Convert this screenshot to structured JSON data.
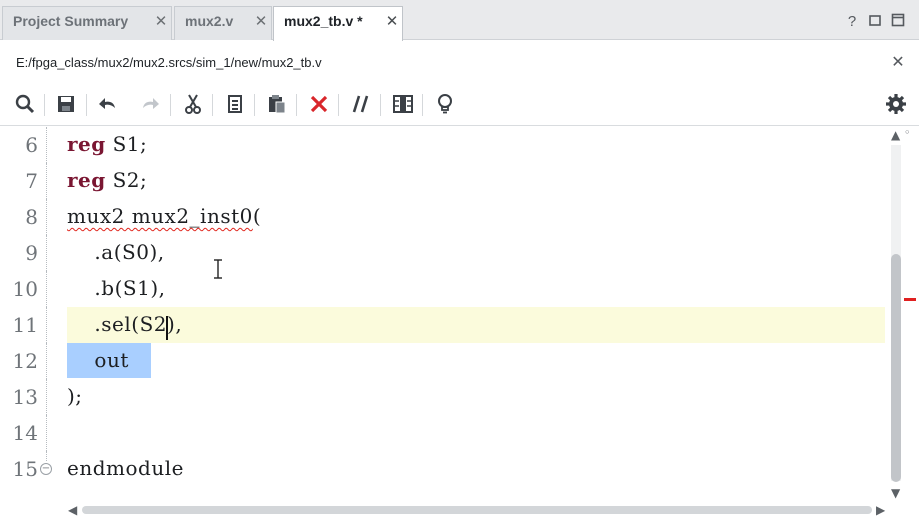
{
  "tabs": [
    {
      "label": "Project Summary",
      "close": "✕"
    },
    {
      "label": "mux2.v",
      "close": "✕"
    },
    {
      "label": "mux2_tb.v *",
      "close": "✕"
    }
  ],
  "window_controls": {
    "help": "?",
    "restore": "☐",
    "maximize": "◻"
  },
  "file_path": "E:/fpga_class/mux2/mux2.srcs/sim_1/new/mux2_tb.v",
  "path_close": "✕",
  "toolbar_icons": [
    "search-icon",
    "save-icon",
    "undo-icon",
    "redo-icon",
    "cut-icon",
    "copy-icon",
    "paste-icon",
    "delete-icon",
    "comment-icon",
    "columns-icon",
    "lightbulb-icon",
    "settings-icon"
  ],
  "editor": {
    "lines": [
      {
        "num": "6",
        "kw": "reg",
        "text": " S1;"
      },
      {
        "num": "7",
        "kw": "reg",
        "text": " S2;"
      },
      {
        "num": "8",
        "squig": "mux2 mux2_inst0",
        "text": "("
      },
      {
        "num": "9",
        "text": "    .a(S0),"
      },
      {
        "num": "10",
        "text": "    .b(S1),"
      },
      {
        "num": "11",
        "before": "    .sel(S2",
        "after": "),"
      },
      {
        "num": "12",
        "text": "    out"
      },
      {
        "num": "13",
        "text": ");"
      },
      {
        "num": "14",
        "text": ""
      },
      {
        "num": "15",
        "text": "endmodule",
        "fold": "⊖"
      }
    ]
  },
  "colors": {
    "keyword": "#7a1632",
    "selection": "#a9cfff",
    "current_line": "#fbfbdc",
    "error": "#e02020"
  }
}
